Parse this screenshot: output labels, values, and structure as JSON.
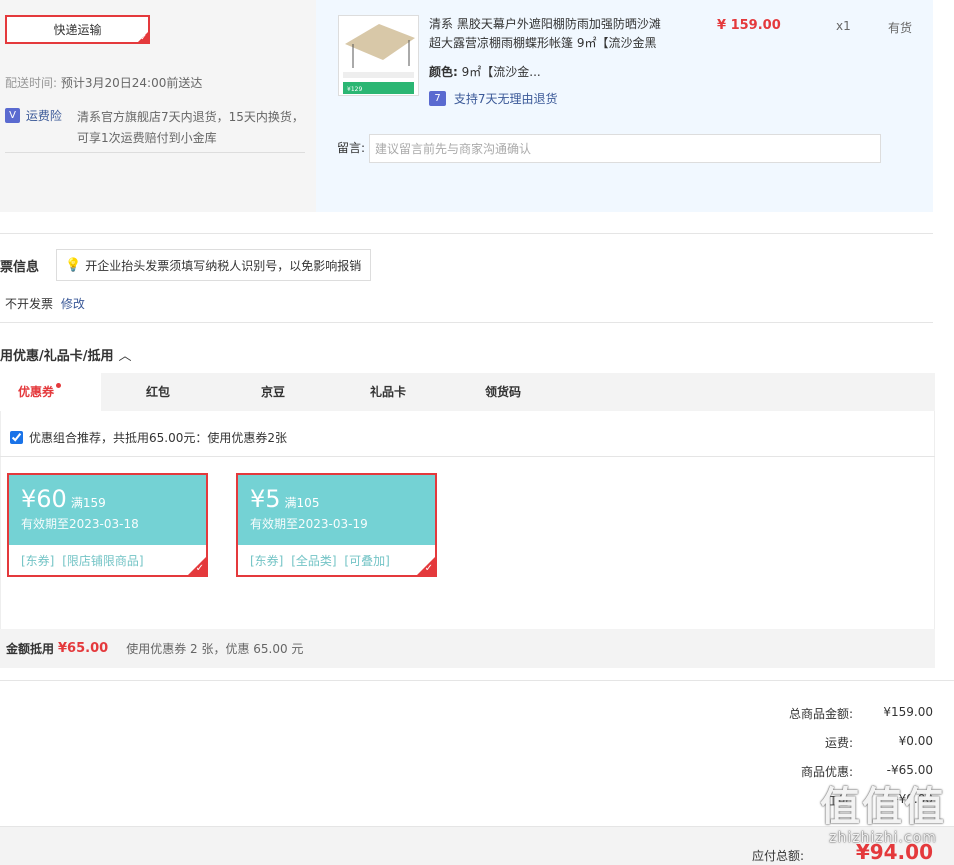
{
  "shipping": {
    "method_label": "快递运输",
    "delivery_label": "配送时间:",
    "delivery_value": "预计3月20日24:00前送达",
    "insurance_icon": "V",
    "insurance_label": "运费险",
    "insurance_desc": "清系官方旗舰店7天内退货，15天内换货，可享1次运费赔付到小金库"
  },
  "product": {
    "name": "清系 黑胶天幕户外遮阳棚防雨加强防晒沙滩超大露营凉棚雨棚蝶形帐篷 9㎡【流沙金黑",
    "price": "¥ 159.00",
    "qty": "x1",
    "stock": "有货",
    "color_label": "颜色:",
    "color_value": "9㎡【流沙金...",
    "return_icon": "7",
    "return_text": "支持7天无理由退货",
    "image_icon": "tent-product-image"
  },
  "memo": {
    "label": "留言:",
    "placeholder": "建议留言前先与商家沟通确认"
  },
  "invoice": {
    "title": "票信息",
    "tip": "开企业抬头发票须填写纳税人识别号，以免影响报销",
    "value": "不开发票",
    "modify": "修改"
  },
  "discount": {
    "title": "用优惠/礼品卡/抵用",
    "tabs": [
      "优惠券",
      "红包",
      "京豆",
      "礼品卡",
      "领货码"
    ],
    "combo_text": "优惠组合推荐，共抵用65.00元：使用优惠券2张",
    "coupons": [
      {
        "amount": "¥60",
        "cond": "满159",
        "expiry": "有效期至2023-03-18",
        "tags": [
          "[东券]",
          "[限店铺限商品]"
        ]
      },
      {
        "amount": "¥5",
        "cond": "满105",
        "expiry": "有效期至2023-03-19",
        "tags": [
          "[东券]",
          "[全品类]",
          "[可叠加]"
        ]
      }
    ],
    "summary_label": "金额抵用",
    "summary_amount": "¥65.00",
    "summary_desc": "使用优惠券 2 张，优惠 65.00 元"
  },
  "totals": {
    "goods_label": "总商品金额:",
    "goods_value": "¥159.00",
    "freight_label": "运费:",
    "freight_value": "¥0.00",
    "promo_label": "商品优惠:",
    "promo_value": "-¥65.00",
    "redpack_label": "红包:",
    "redpack_value": "-¥0.00",
    "payable_label": "应付总额:",
    "payable_value": "¥94.00"
  },
  "watermark": {
    "big": "值值值",
    "small": "zhizhizhi.com"
  },
  "colors": {
    "accent_red": "#e4393c",
    "coupon_teal": "#74d2d4",
    "link_blue": "#3b5998"
  }
}
